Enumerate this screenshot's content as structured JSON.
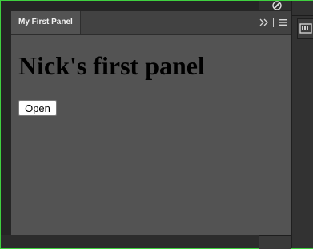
{
  "panel": {
    "tab_label": "My First Panel",
    "heading": "Nick's first panel",
    "open_button_label": "Open"
  },
  "icons": {
    "expand": "double-chevron-right-icon",
    "menu": "hamburger-menu-icon",
    "dock_tool": "brush-icon",
    "dock_button": "library-icon"
  },
  "colors": {
    "panel_bg": "#535353",
    "header_bg": "#424242",
    "frame_border": "#3fd03f"
  }
}
